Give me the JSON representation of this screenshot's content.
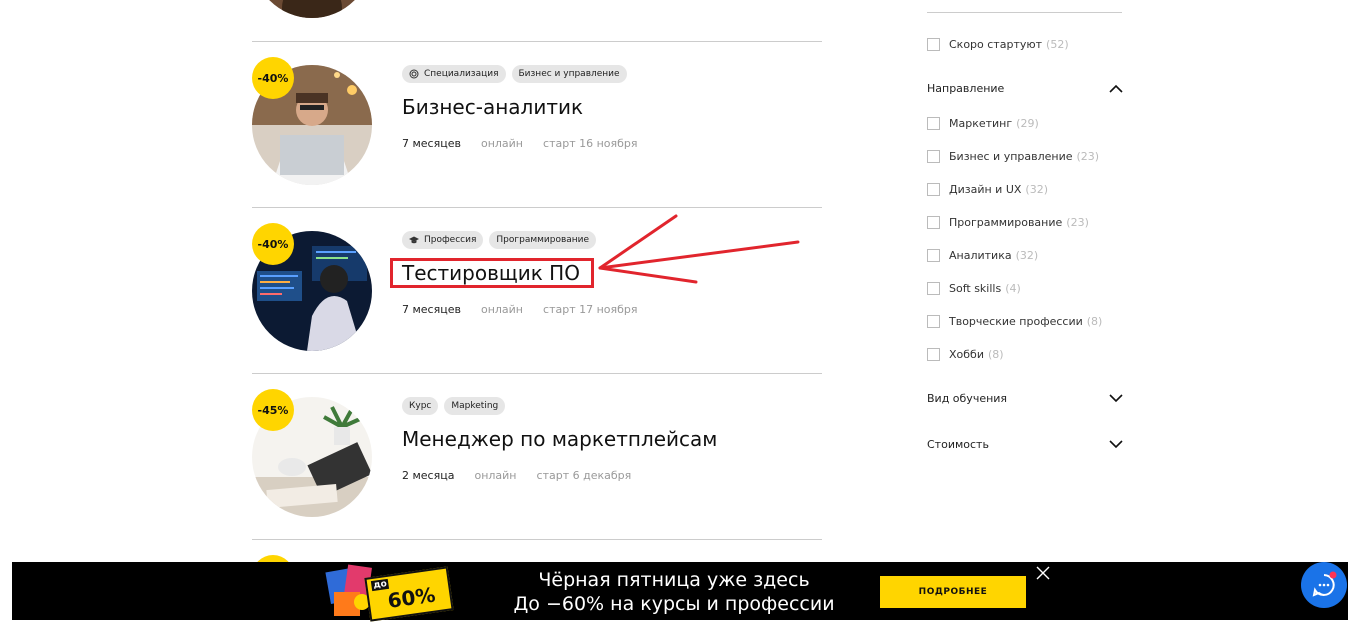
{
  "courses": [
    {
      "discount": "-40%",
      "tags": [
        {
          "icon": "target-icon",
          "label": "Специализация"
        },
        {
          "label": "Бизнес и управление"
        }
      ],
      "title": "Бизнес-аналитик",
      "duration": "7 месяцев",
      "format": "онлайн",
      "start": "старт 16 ноября"
    },
    {
      "discount": "-40%",
      "tags": [
        {
          "icon": "graduation-cap-icon",
          "label": "Профессия"
        },
        {
          "label": "Программирование"
        }
      ],
      "title": "Тестировщик ПО",
      "duration": "7 месяцев",
      "format": "онлайн",
      "start": "старт 17 ноября"
    },
    {
      "discount": "-45%",
      "tags": [
        {
          "label": "Курс"
        },
        {
          "label": "Марketing"
        }
      ],
      "title": "Менеджер по маркетплейсам",
      "duration": "2 месяца",
      "format": "онлайн",
      "start": "старт 6 декабря"
    }
  ],
  "sidebar": {
    "soon": {
      "label": "Скоро стартуют",
      "count": "(52)"
    },
    "direction": {
      "title": "Направление",
      "items": [
        {
          "label": "Маркетинг",
          "count": "(29)"
        },
        {
          "label": "Бизнес и управление",
          "count": "(23)"
        },
        {
          "label": "Дизайн и UX",
          "count": "(32)"
        },
        {
          "label": "Программирование",
          "count": "(23)"
        },
        {
          "label": "Аналитика",
          "count": "(32)"
        },
        {
          "label": "Soft skills",
          "count": "(4)"
        },
        {
          "label": "Творческие профессии",
          "count": "(8)"
        },
        {
          "label": "Хобби",
          "count": "(8)"
        }
      ]
    },
    "study_type": {
      "title": "Вид обучения"
    },
    "price": {
      "title": "Стоимость"
    }
  },
  "banner": {
    "badge_prefix": "до",
    "badge_value": "60%",
    "line1": "Чёрная пятница уже здесь",
    "line2": "До −60% на курсы и професcии",
    "button": "ПОДРОБНЕЕ"
  },
  "colors": {
    "accent_yellow": "#ffd500",
    "highlight_red": "#e1252d",
    "chat_blue": "#1a73e8"
  }
}
